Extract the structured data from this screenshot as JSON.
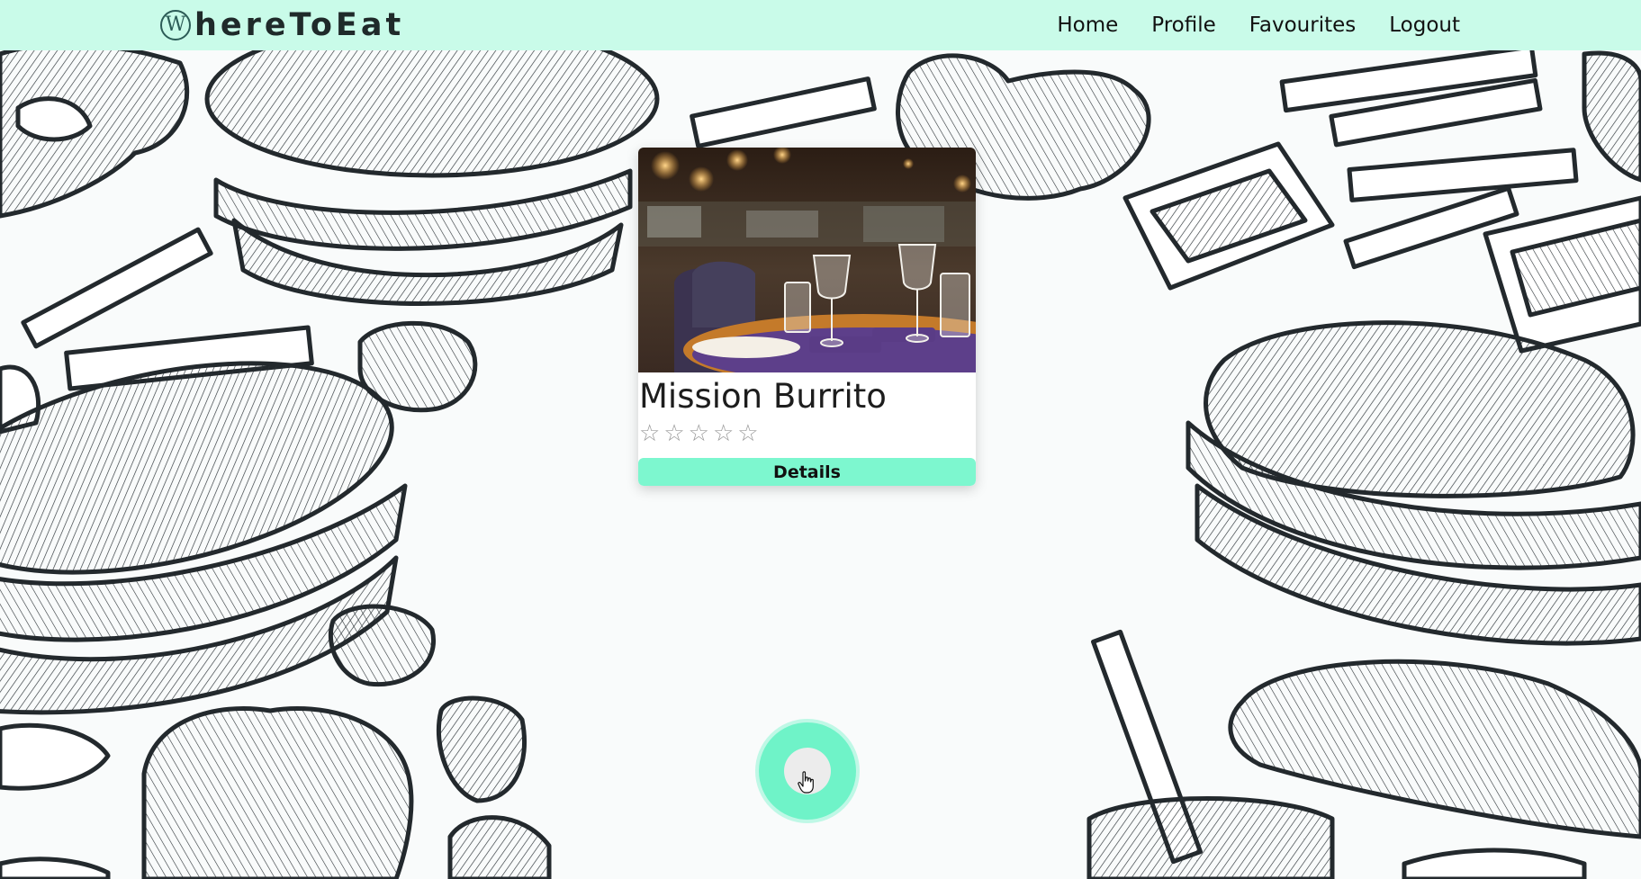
{
  "app": {
    "logo_mark": "W",
    "logo_text": "hereToEat"
  },
  "nav": {
    "items": [
      {
        "label": "Home"
      },
      {
        "label": "Profile"
      },
      {
        "label": "Favourites"
      },
      {
        "label": "Logout"
      }
    ]
  },
  "card": {
    "title": "Mission Burrito",
    "rating": 0,
    "max_rating": 5,
    "star_glyph": "☆",
    "details_label": "Details",
    "image_icon": "restaurant-photo"
  },
  "colors": {
    "navbar": "#c9fbe9",
    "accent": "#7df7cf",
    "fab": "#6ff3c8"
  },
  "fab": {
    "icon": "pointer-hand-icon"
  }
}
